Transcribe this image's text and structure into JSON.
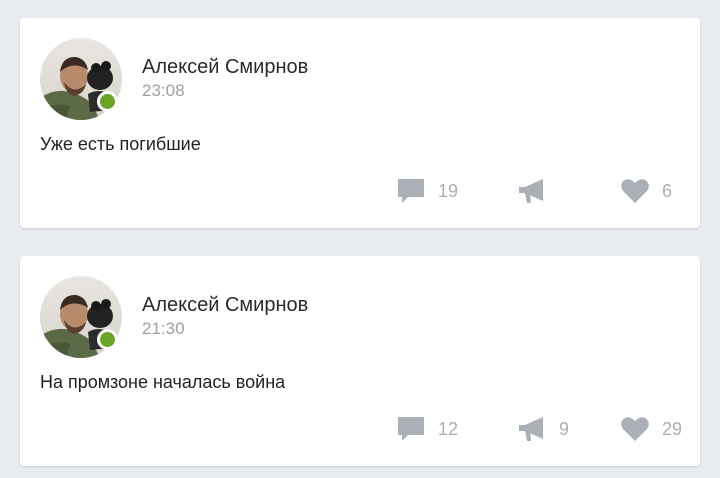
{
  "colors": {
    "background": "#e8ebf0",
    "card": "#ffffff",
    "online_indicator": "#6aa626",
    "action_icon": "#aab0b6"
  },
  "posts": [
    {
      "author": "Алексей Смирнов",
      "time": "23:08",
      "text": "Уже есть погибшие",
      "online": true,
      "actions": {
        "comments": {
          "icon": "comment-icon",
          "count": "19"
        },
        "reposts": {
          "icon": "megaphone-icon",
          "count": ""
        },
        "likes": {
          "icon": "heart-icon",
          "count": "6"
        }
      }
    },
    {
      "author": "Алексей Смирнов",
      "time": "21:30",
      "text": "На промзоне началась война",
      "online": true,
      "actions": {
        "comments": {
          "icon": "comment-icon",
          "count": "12"
        },
        "reposts": {
          "icon": "megaphone-icon",
          "count": "9"
        },
        "likes": {
          "icon": "heart-icon",
          "count": "29"
        }
      }
    }
  ]
}
